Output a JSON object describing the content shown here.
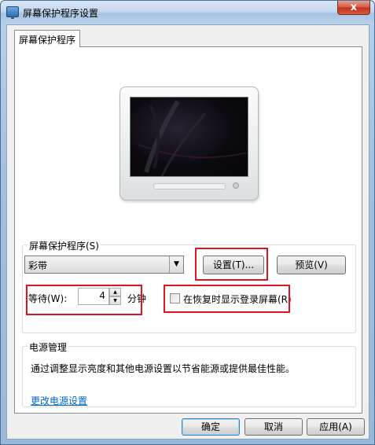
{
  "window": {
    "title": "屏幕保护程序设置",
    "close_glyph": "x"
  },
  "tab": {
    "label": "屏幕保护程序"
  },
  "screensaver": {
    "group_label": "屏幕保护程序(S)",
    "selected": "彩带",
    "settings_button": "设置(T)...",
    "preview_button": "预览(V)",
    "wait_label": "等待(W):",
    "wait_value": "4",
    "wait_unit": "分钟",
    "resume_label": "在恢复时显示登录屏幕(R)",
    "resume_checked": false
  },
  "power": {
    "group_label": "电源管理",
    "description": "通过调整显示亮度和其他电源设置以节省能源或提供最佳性能。",
    "link": "更改电源设置"
  },
  "footer": {
    "ok": "确定",
    "cancel": "取消",
    "apply": "应用(A)"
  },
  "colors": {
    "highlight_box": "#e0141e",
    "link": "#0066cc"
  }
}
